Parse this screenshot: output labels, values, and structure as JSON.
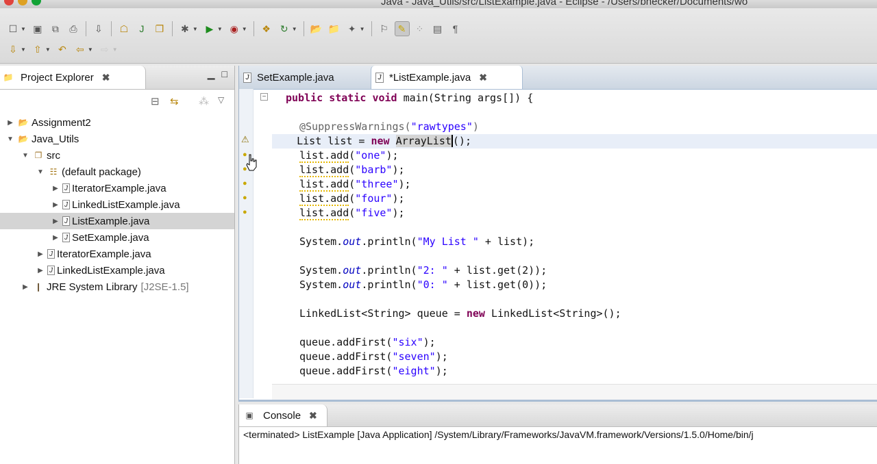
{
  "window": {
    "title": "Java - Java_Utils/src/ListExample.java - Eclipse - /Users/bhecker/Documents/wo"
  },
  "toolbar": {
    "row1": [
      "new-icon",
      "save-icon",
      "save-all-icon",
      "print-icon",
      "import-icon",
      "new-project-icon",
      "new-class-icon",
      "new-interface-icon",
      "debug-icon",
      "run-icon",
      "run-external-icon",
      "new-server-icon",
      "refresh-icon",
      "open-folder-icon",
      "open-file-icon",
      "search-icon",
      "pin-icon",
      "highlight-icon",
      "toggle-icon",
      "block-icon",
      "pilcrow-icon"
    ],
    "row2": [
      "next-annotation-icon",
      "prev-annotation-icon",
      "last-edit-icon",
      "back-icon",
      "forward-icon"
    ]
  },
  "project_explorer": {
    "title": "Project Explorer",
    "tree": [
      {
        "label": "Assignment2",
        "level": 0,
        "expanded": false,
        "type": "project"
      },
      {
        "label": "Java_Utils",
        "level": 0,
        "expanded": true,
        "type": "project"
      },
      {
        "label": "src",
        "level": 1,
        "expanded": true,
        "type": "src"
      },
      {
        "label": "(default package)",
        "level": 2,
        "expanded": true,
        "type": "package"
      },
      {
        "label": "IteratorExample.java",
        "level": 3,
        "expanded": false,
        "type": "file"
      },
      {
        "label": "LinkedListExample.java",
        "level": 3,
        "expanded": false,
        "type": "file"
      },
      {
        "label": "ListExample.java",
        "level": 3,
        "expanded": false,
        "type": "file",
        "selected": true
      },
      {
        "label": "SetExample.java",
        "level": 3,
        "expanded": false,
        "type": "file"
      },
      {
        "label": "IteratorExample.java",
        "level": 2,
        "expanded": false,
        "type": "file"
      },
      {
        "label": "LinkedListExample.java",
        "level": 2,
        "expanded": false,
        "type": "file"
      },
      {
        "label": "JRE System Library",
        "suffix": "[J2SE-1.5]",
        "level": 1,
        "expanded": false,
        "type": "library"
      }
    ]
  },
  "editor": {
    "tabs": [
      {
        "label": "SetExample.java",
        "active": false
      },
      {
        "label": "*ListExample.java",
        "active": true
      }
    ]
  },
  "console": {
    "title": "Console",
    "status": "<terminated> ListExample [Java Application] /System/Library/Frameworks/JavaVM.framework/Versions/1.5.0/Home/bin/j"
  }
}
